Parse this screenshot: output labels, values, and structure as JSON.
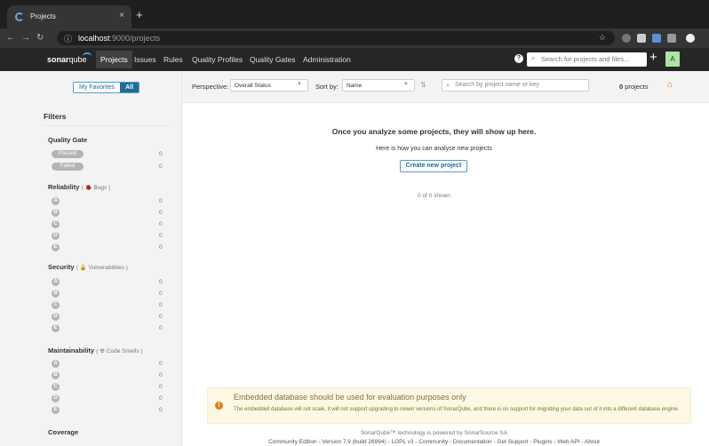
{
  "browser": {
    "tab_title": "Projects",
    "tab_close": "×",
    "new_tab": "+",
    "url_host": "localhost",
    "url_path": ":9000/projects"
  },
  "nav": {
    "logo_bold": "sonar",
    "logo_thin": "qube",
    "items": [
      "Projects",
      "Issues",
      "Rules",
      "Quality Profiles",
      "Quality Gates",
      "Administration"
    ],
    "help": "?",
    "search_placeholder": "Search for projects and files...",
    "plus": "+",
    "avatar": "A"
  },
  "sidebar": {
    "favorites_label": "My Favorites",
    "all_label": "All",
    "filters_title": "Filters",
    "quality_gate": {
      "title": "Quality Gate",
      "options": [
        {
          "label": "Passed",
          "count": "0"
        },
        {
          "label": "Failed",
          "count": "0"
        }
      ]
    },
    "reliability": {
      "title": "Reliability",
      "sub": "Bugs"
    },
    "security": {
      "title": "Security",
      "sub": "Vulnerabilities"
    },
    "maintainability": {
      "title": "Maintainability",
      "sub": "Code Smells"
    },
    "coverage": {
      "title": "Coverage"
    },
    "ratings": [
      "A",
      "B",
      "C",
      "D",
      "E"
    ],
    "zero": "0"
  },
  "toolbar": {
    "perspective_label": "Perspective:",
    "perspective_value": "Overall Status",
    "sort_label": "Sort by:",
    "sort_value": "Name",
    "search_placeholder": "Search by project name or key",
    "count_value": "0",
    "count_label": "projects"
  },
  "main": {
    "empty_title": "Once you analyze some projects, they will show up here.",
    "empty_sub": "Here is how you can analyse new projects",
    "create_button": "Create new project",
    "shown": "0 of 0 shown"
  },
  "warning": {
    "icon": "!",
    "title": "Embedded database should be used for evaluation purposes only",
    "body": "The embedded database will not scale, it will not support upgrading to newer versions of SonarQube, and there is no support for migrating your data out of it into a different database engine."
  },
  "footer": {
    "line1": "SonarQube™ technology is powered by SonarSource SA",
    "line2": "Community Edition - Version 7.9 (build 26994) - LGPL v3 - Community - Documentation - Get Support - Plugins - Web API - About"
  }
}
